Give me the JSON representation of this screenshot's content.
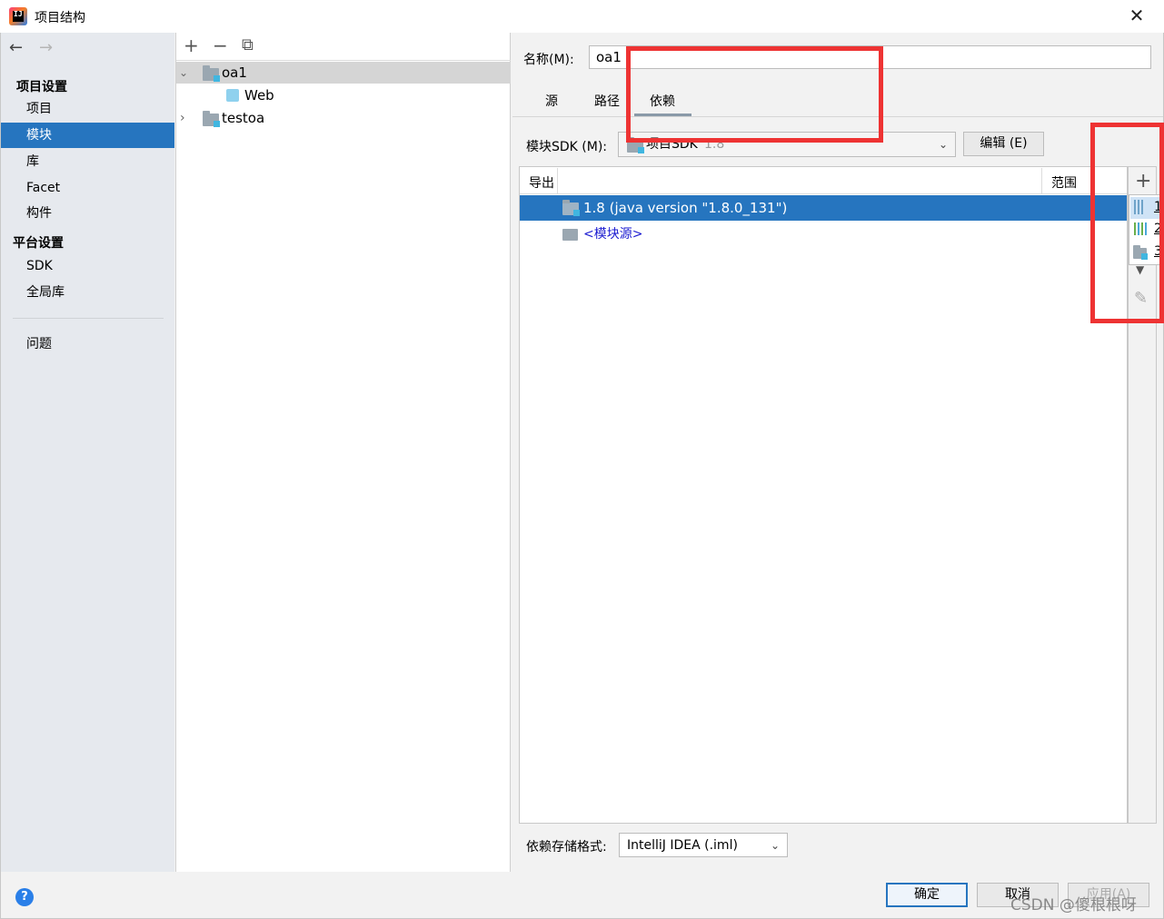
{
  "window": {
    "title": "项目结构"
  },
  "nav": {
    "back": "←",
    "forward": "→",
    "project_settings_title": "项目设置",
    "project_items": [
      "项目",
      "模块",
      "库",
      "Facet",
      "构件"
    ],
    "platform_settings_title": "平台设置",
    "platform_items": [
      "SDK",
      "全局库"
    ],
    "problems": "问题",
    "selected": "模块"
  },
  "module_tree": {
    "toolbar": {
      "add": "+",
      "remove": "−",
      "copy": "⧉"
    },
    "nodes": [
      {
        "label": "oa1",
        "expanded": true,
        "selected": true
      },
      {
        "label": "Web",
        "child": true
      },
      {
        "label": "testoa",
        "expanded": false
      }
    ]
  },
  "module": {
    "name_label": "名称(M):",
    "name_value": "oa1",
    "tabs": [
      "源",
      "路径",
      "依赖"
    ],
    "active_tab": "依赖",
    "sdk_label": "模块SDK (M):",
    "sdk_value": "项目SDK",
    "sdk_version": "1.8",
    "edit_button": "编辑 (E)",
    "table": {
      "col_export": "导出",
      "col_scope": "范围",
      "rows": [
        {
          "label": "1.8 (java version \"1.8.0_131\")",
          "selected": true
        },
        {
          "label": "<模块源>",
          "selected": false
        }
      ]
    },
    "add_menu": [
      "1",
      "2",
      "3"
    ],
    "storage_label": "依赖存储格式:",
    "storage_value": "IntelliJ IDEA (.iml)"
  },
  "footer": {
    "ok": "确定",
    "cancel": "取消",
    "apply": "应用(A)",
    "help": "?",
    "watermark": "CSDN @傻根根呀"
  },
  "colors": {
    "selection": "#2675bf",
    "highlight_box": "#ee3333",
    "sidebar": "#e6e9ee"
  }
}
